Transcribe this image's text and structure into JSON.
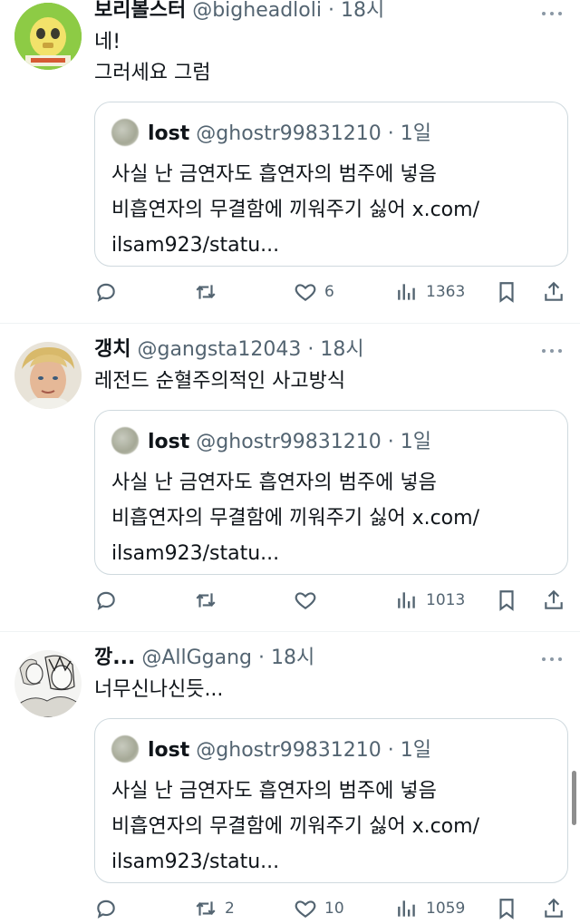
{
  "tweets": [
    {
      "name": "보리볼스터",
      "handle": "@bigheadloli",
      "sep": "·",
      "time": "18시",
      "text": "네!\n그러세요 그럼",
      "quote": {
        "name": "lost",
        "handle": "@ghostr99831210",
        "sep": "·",
        "time": "1일",
        "text": "사실 난 금연자도 흡연자의 범주에 넣음\n비흡연자의 무결함에 끼워주기 싫어 x.com/\nilsam923/statu..."
      },
      "replies": "",
      "retweets": "",
      "likes": "6",
      "views": "1363"
    },
    {
      "name": "갱치",
      "handle": "@gangsta12043",
      "sep": "·",
      "time": "18시",
      "text": "레전드 순혈주의적인 사고방식",
      "quote": {
        "name": "lost",
        "handle": "@ghostr99831210",
        "sep": "·",
        "time": "1일",
        "text": "사실 난 금연자도 흡연자의 범주에 넣음\n비흡연자의 무결함에 끼워주기 싫어 x.com/\nilsam923/statu..."
      },
      "replies": "",
      "retweets": "",
      "likes": "",
      "views": "1013"
    },
    {
      "name": "깡...",
      "handle": "@AllGgang",
      "sep": "·",
      "time": "18시",
      "text": "너무신나신듯...",
      "quote": {
        "name": "lost",
        "handle": "@ghostr99831210",
        "sep": "·",
        "time": "1일",
        "text": "사실 난 금연자도 흡연자의 범주에 넣음\n비흡연자의 무결함에 끼워주기 싫어 x.com/\nilsam923/statu..."
      },
      "replies": "",
      "retweets": "2",
      "likes": "10",
      "views": "1059"
    }
  ],
  "icons": {
    "reply": "reply-icon",
    "retweet": "retweet-icon",
    "like": "heart-icon",
    "views": "views-icon",
    "bookmark": "bookmark-icon",
    "share": "share-icon",
    "more": "more-icon"
  },
  "colors": {
    "text": "#0f1419",
    "secondary": "#536471",
    "border": "#cfd9de",
    "divider": "#eff3f4"
  }
}
